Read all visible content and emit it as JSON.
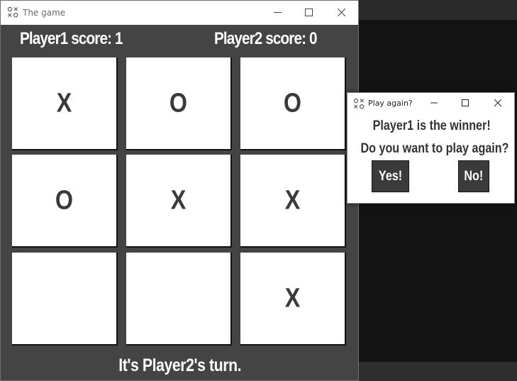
{
  "main_window": {
    "title": "The game",
    "player1_score": "Player1 score:  1",
    "player2_score": "Player2 score: 0",
    "status": "It's Player2's turn.",
    "board": [
      "X",
      "O",
      "O",
      "O",
      "X",
      "X",
      "",
      "",
      "X"
    ]
  },
  "dialog": {
    "title": "Play again?",
    "message": "Player1 is the winner!",
    "question": "Do you want to play again?",
    "yes_label": "Yes!",
    "no_label": "No!"
  },
  "icons": {
    "app": "tic-tac-toe-icon",
    "minimize": "minimize-icon",
    "maximize": "maximize-icon",
    "close": "close-icon"
  },
  "colors": {
    "window_bg": "#444444",
    "cell_bg": "#ffffff",
    "mark": "#3a3a3a",
    "button_bg": "#3b3b3b"
  }
}
